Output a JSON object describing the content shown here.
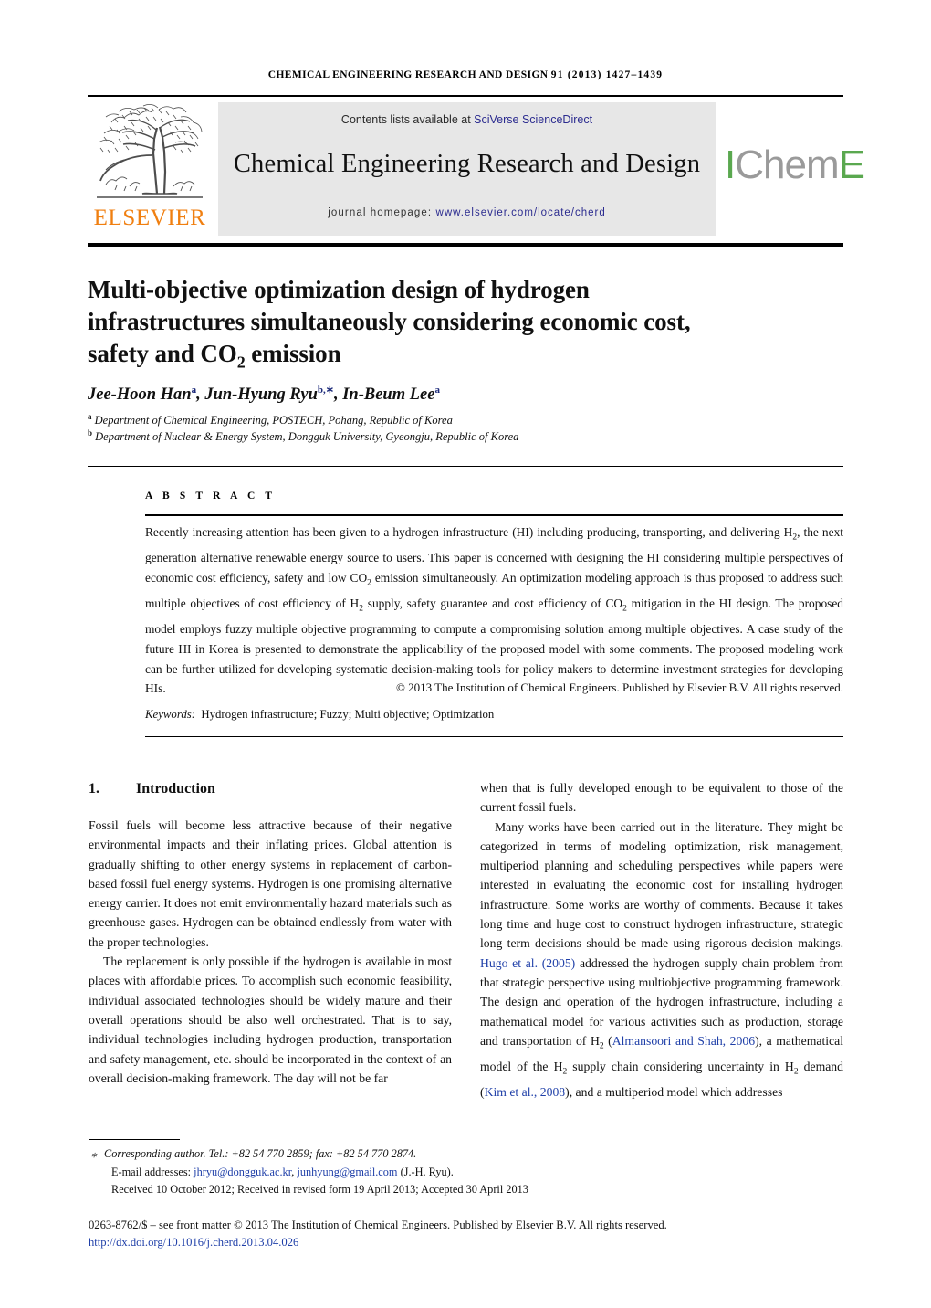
{
  "running_head": {
    "journal": "CHEMICAL ENGINEERING RESEARCH AND DESIGN",
    "volume_issue_pages": "91 (2013) 1427–1439"
  },
  "masthead": {
    "contents_prefix": "Contents lists available at ",
    "contents_link": "SciVerse ScienceDirect",
    "journal_title": "Chemical Engineering Research and Design",
    "homepage_prefix": "journal homepage: ",
    "homepage_link": "www.elsevier.com/locate/cherd",
    "publisher_wordmark": "ELSEVIER",
    "society_logo": {
      "part1": "I",
      "part2": "Chem",
      "part3": "E"
    },
    "colors": {
      "banner_bg": "#e7e7e7",
      "link_blue": "#2b2b8f",
      "elsevier_orange": "#f07f10",
      "icheme_green": "#5aa84f",
      "icheme_grey": "#9a9a9a"
    }
  },
  "article": {
    "title_line1": "Multi-objective optimization design of hydrogen",
    "title_line2": "infrastructures simultaneously considering economic cost,",
    "title_line3_a": "safety and CO",
    "title_line3_sub": "2",
    "title_line3_b": " emission",
    "authors": [
      {
        "name": "Jee-Hoon Han",
        "marks": "a"
      },
      {
        "name": "Jun-Hyung Ryu",
        "marks": "b,∗"
      },
      {
        "name": "In-Beum Lee",
        "marks": "a"
      }
    ],
    "affiliations": [
      {
        "mark": "a",
        "text": "Department of Chemical Engineering, POSTECH, Pohang, Republic of Korea"
      },
      {
        "mark": "b",
        "text": "Department of Nuclear & Energy System, Dongguk University, Gyeongju, Republic of Korea"
      }
    ]
  },
  "abstract": {
    "label": "A B S T R A C T",
    "p1_a": "Recently increasing attention has been given to a hydrogen infrastructure (HI) including producing, transporting, and delivering H",
    "p1_sub1": "2",
    "p1_b": ", the next generation alternative renewable energy source to users. This paper is concerned with designing the HI considering multiple perspectives of economic cost efficiency, safety and low CO",
    "p1_sub2": "2",
    "p1_c": " emission simultaneously. An optimization modeling approach is thus proposed to address such multiple objectives of cost efficiency of H",
    "p1_sub3": "2",
    "p1_d": " supply, safety guarantee and cost efficiency of CO",
    "p1_sub4": "2",
    "p1_e": " mitigation in the HI design. The proposed model employs fuzzy multiple objective programming to compute a compromising solution among multiple objectives. A case study of the future HI in Korea is presented to demonstrate the applicability of the proposed model with some comments. The proposed modeling work can be further utilized for developing systematic decision-making tools for policy makers to determine investment strategies for developing HIs.",
    "copyright": "© 2013 The Institution of Chemical Engineers. Published by Elsevier B.V. All rights reserved.",
    "keywords_label": "Keywords:",
    "keywords_value": "Hydrogen infrastructure; Fuzzy; Multi objective; Optimization"
  },
  "body": {
    "section_number": "1.",
    "section_title": "Introduction",
    "left_p1": "Fossil fuels will become less attractive because of their negative environmental impacts and their inflating prices. Global attention is gradually shifting to other energy systems in replacement of carbon-based fossil fuel energy systems. Hydrogen is one promising alternative energy carrier. It does not emit environmentally hazard materials such as greenhouse gases. Hydrogen can be obtained endlessly from water with the proper technologies.",
    "left_p2": "The replacement is only possible if the hydrogen is available in most places with affordable prices. To accomplish such economic feasibility, individual associated technologies should be widely mature and their overall operations should be also well orchestrated. That is to say, individual technologies including hydrogen production, transportation and safety management, etc. should be incorporated in the context of an overall decision-making framework. The day will not be far",
    "right_p1": "when that is fully developed enough to be equivalent to those of the current fossil fuels.",
    "right_p2_a": "Many works have been carried out in the literature. They might be categorized in terms of modeling optimization, risk management, multiperiod planning and scheduling perspectives while papers were interested in evaluating the economic cost for installing hydrogen infrastructure. Some works are worthy of comments. Because it takes long time and huge cost to construct hydrogen infrastructure, strategic long term decisions should be made using rigorous decision makings. ",
    "right_cite1": "Hugo et al. (2005)",
    "right_p2_b": " addressed the hydrogen supply chain problem from that strategic perspective using multiobjective programming framework. The design and operation of the hydrogen infrastructure, including a mathematical model for various activities such as production, storage and transportation of H",
    "right_sub1": "2",
    "right_p2_c": " (",
    "right_cite2": "Almansoori and Shah, 2006",
    "right_p2_d": "), a mathematical model of the H",
    "right_sub2": "2",
    "right_p2_e": " supply chain considering uncertainty in H",
    "right_sub3": "2",
    "right_p2_f": " demand (",
    "right_cite3": "Kim et al., 2008",
    "right_p2_g": "), and a multiperiod model which addresses"
  },
  "footer": {
    "corresponding": "Corresponding author. Tel.: +82 54 770 2859; fax: +82 54 770 2874.",
    "email_label": "E-mail addresses:",
    "email1": "jhryu@dongguk.ac.kr",
    "email2": "junhyung@gmail.com",
    "email_suffix": "(J.-H. Ryu).",
    "dates": "Received 10 October 2012; Received in revised form 19 April 2013; Accepted 30 April 2013",
    "issn_line": "0263-8762/$ – see front matter © 2013 The Institution of Chemical Engineers. Published by Elsevier B.V. All rights reserved.",
    "doi": "http://dx.doi.org/10.1016/j.cherd.2013.04.026"
  }
}
